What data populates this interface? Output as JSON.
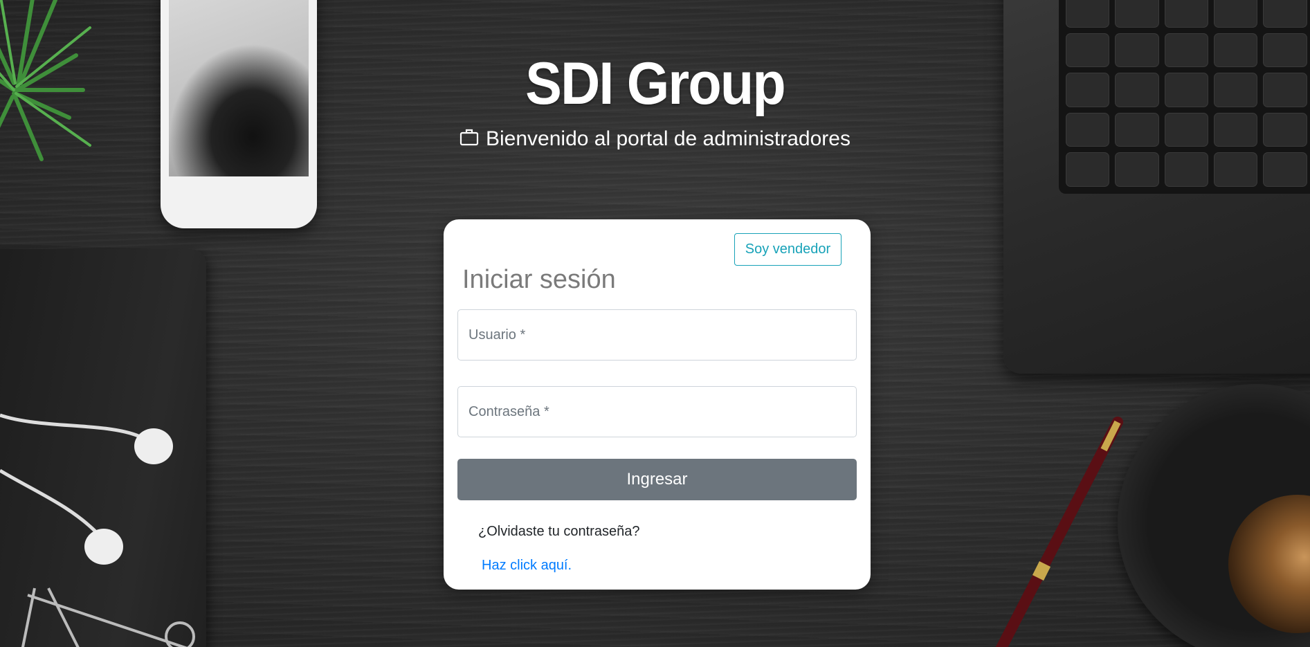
{
  "brand": {
    "title": "SDI Group"
  },
  "header": {
    "icon": "briefcase-icon",
    "tagline": "Bienvenido al portal de administradores"
  },
  "login": {
    "vendor_button": "Soy vendedor",
    "title": "Iniciar sesión",
    "username_placeholder": "Usuario *",
    "username_value": "",
    "password_placeholder": "Contraseña *",
    "password_value": "",
    "submit_label": "Ingresar",
    "forgot_text": "¿Olvidaste tu contraseña?",
    "forgot_link": "Haz click aquí."
  },
  "colors": {
    "accent_info": "#17a2b8",
    "button_secondary": "#6c757d",
    "link": "#007bff",
    "title_gray": "#7a7a7a"
  }
}
